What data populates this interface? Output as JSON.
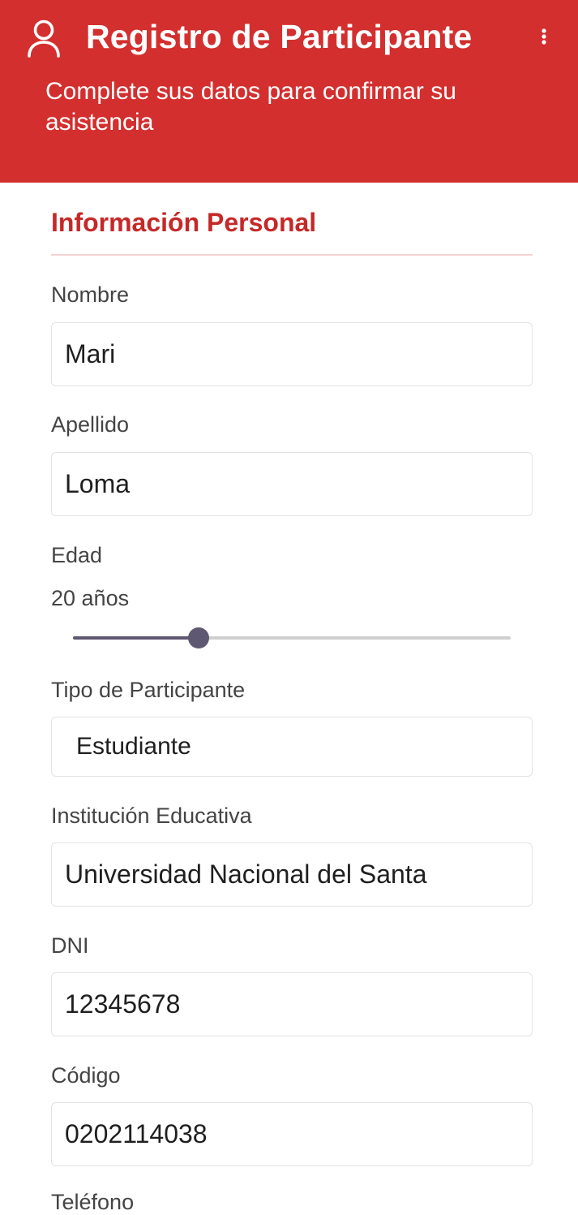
{
  "header": {
    "title": "Registro de Participante",
    "subtitle": "Complete sus datos para confirmar su asistencia",
    "background_color": "#d32f2f",
    "user_icon": "person-outline-icon",
    "menu_icon": "more-vert-icon"
  },
  "section": {
    "title": "Información Personal",
    "accent_color": "#c62828"
  },
  "fields": {
    "nombre": {
      "label": "Nombre",
      "value": "Mari"
    },
    "apellido": {
      "label": "Apellido",
      "value": "Loma"
    },
    "edad": {
      "label": "Edad",
      "value_text": "20 años",
      "slider_fraction": 0.287,
      "slider_color": "#5f5872"
    },
    "tipo": {
      "label": "Tipo de Participante",
      "value": "Estudiante"
    },
    "institucion": {
      "label": "Institución Educativa",
      "value": "Universidad Nacional del Santa"
    },
    "dni": {
      "label": "DNI",
      "value": "12345678"
    },
    "codigo": {
      "label": "Código",
      "value": "0202114038"
    },
    "telefono": {
      "label": "Teléfono"
    }
  }
}
